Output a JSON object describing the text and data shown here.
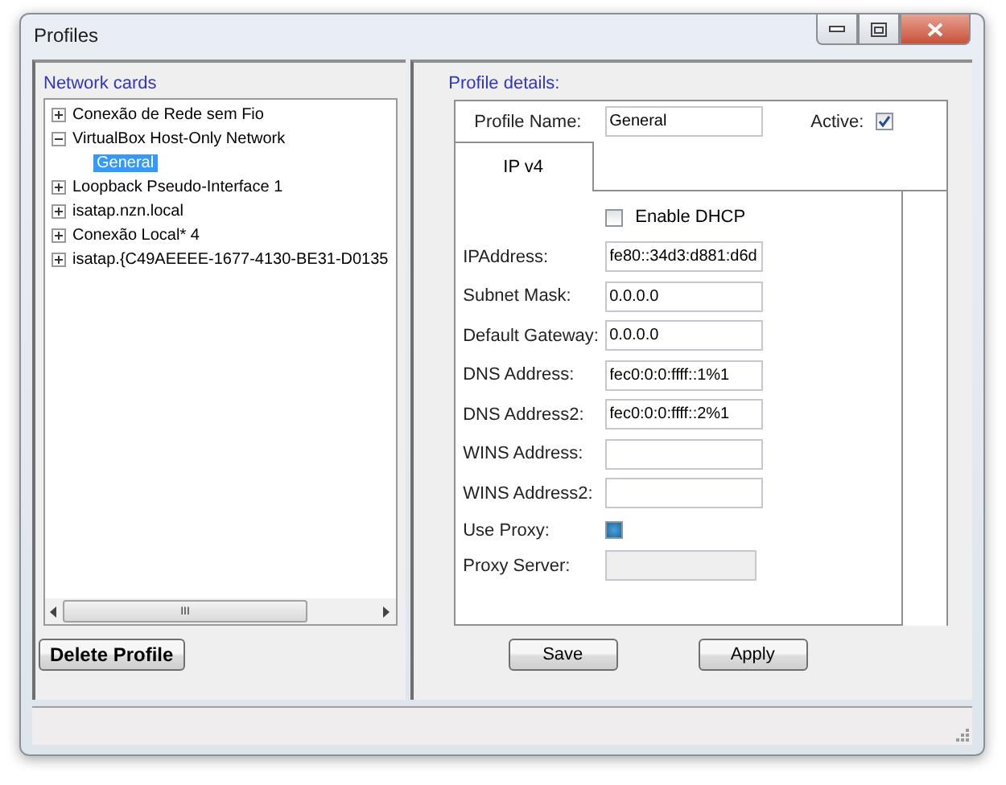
{
  "window": {
    "title": "Profiles"
  },
  "network_cards": {
    "heading": "Network cards",
    "tree": [
      {
        "label": "Conexão de Rede sem Fio",
        "expanded": false,
        "selected": false
      },
      {
        "label": "VirtualBox Host-Only Network",
        "expanded": true,
        "selected": false,
        "children": [
          {
            "label": "General",
            "selected": true
          }
        ]
      },
      {
        "label": "Loopback Pseudo-Interface 1",
        "expanded": false,
        "selected": false
      },
      {
        "label": "isatap.nzn.local",
        "expanded": false,
        "selected": false
      },
      {
        "label": "Conexão Local* 4",
        "expanded": false,
        "selected": false
      },
      {
        "label": "isatap.{C49AEEEE-1677-4130-BE31-D0135",
        "expanded": false,
        "selected": false
      }
    ],
    "scroll_grip": "III",
    "delete_button": "Delete Profile"
  },
  "profile_details": {
    "heading": "Profile details:",
    "profile_name_label": "Profile Name:",
    "profile_name": "General",
    "active_label": "Active:",
    "active": true,
    "tabs": [
      {
        "label": "IP v4",
        "selected": true
      }
    ],
    "enable_dhcp": {
      "label": "Enable DHCP",
      "checked": false
    },
    "fields": [
      {
        "kind": "text",
        "label": "IPAddress:",
        "value": "fe80::34d3:d881:d6d"
      },
      {
        "kind": "text",
        "label": "Subnet Mask:",
        "value": "0.0.0.0"
      },
      {
        "kind": "text",
        "label": "Default Gateway:",
        "value": "0.0.0.0"
      },
      {
        "kind": "text",
        "label": "DNS Address:",
        "value": "fec0:0:0:ffff::1%1"
      },
      {
        "kind": "text",
        "label": "DNS Address2:",
        "value": "fec0:0:0:ffff::2%1"
      },
      {
        "kind": "text",
        "label": "WINS Address:"
      },
      {
        "kind": "text",
        "label": "WINS Address2:"
      },
      {
        "kind": "checkbox",
        "label": "Use Proxy:",
        "checked": true
      },
      {
        "kind": "text",
        "label": "Proxy Server:",
        "disabled": true
      }
    ],
    "buttons": [
      "Save",
      "Apply"
    ]
  }
}
